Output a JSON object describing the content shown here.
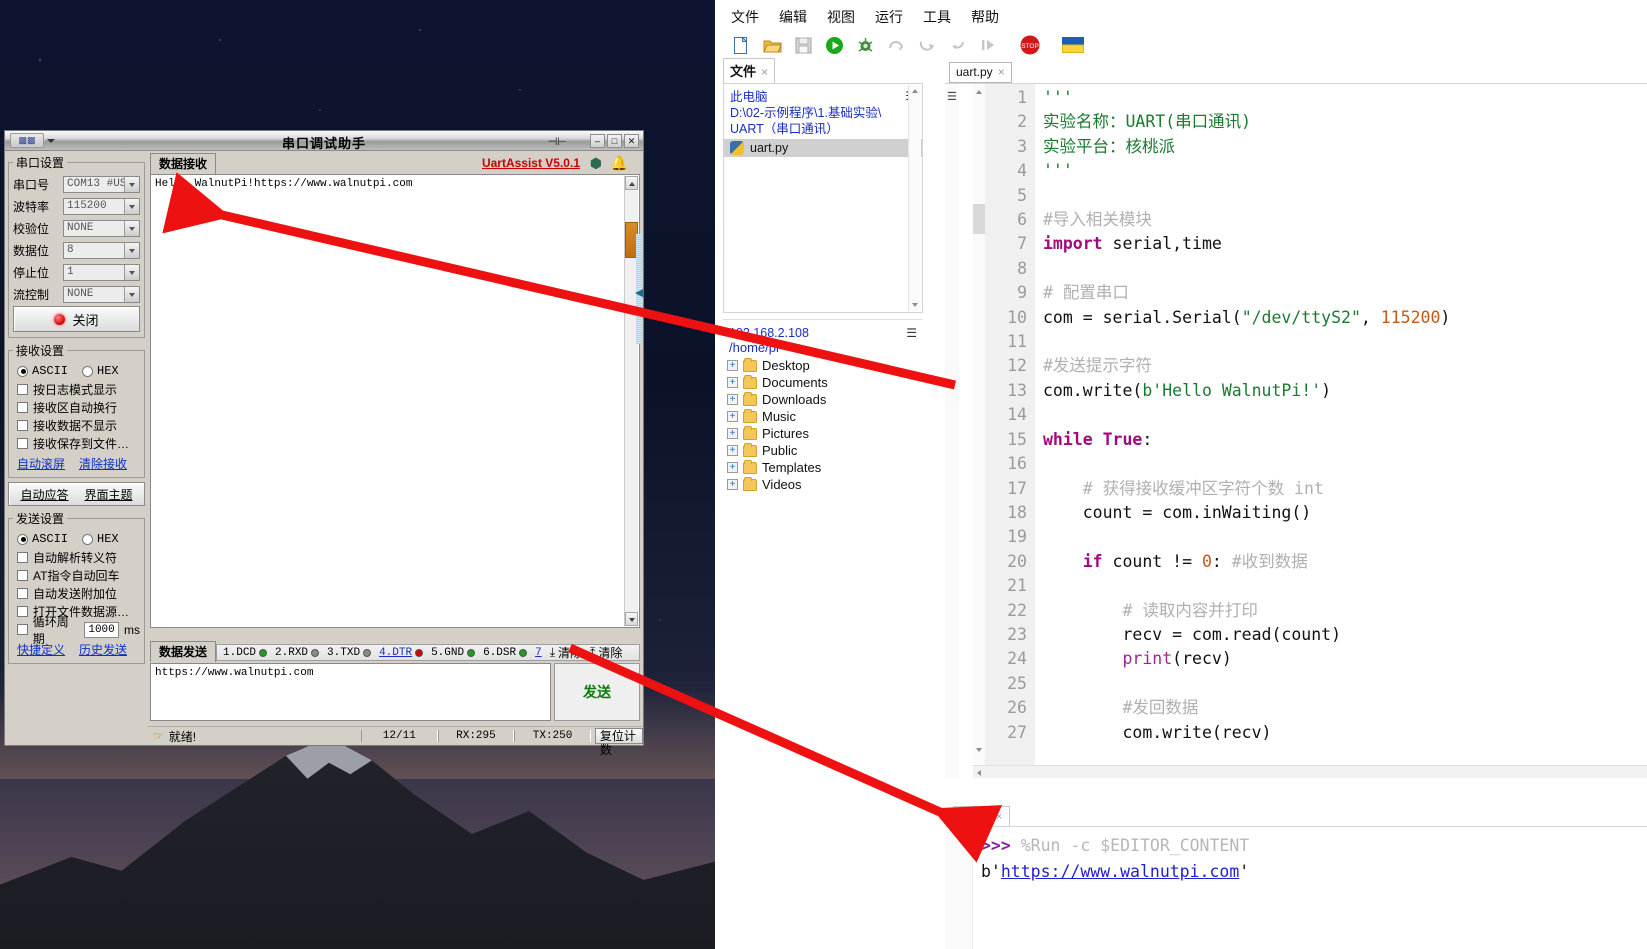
{
  "serial_window": {
    "title": "串口调试助手",
    "logo_label": "",
    "titlebar_buttons": [
      "–",
      "□",
      "✕"
    ],
    "serial_settings": {
      "legend": "串口设置",
      "fields": [
        {
          "label": "串口号",
          "value": "COM13 #US"
        },
        {
          "label": "波特率",
          "value": "115200"
        },
        {
          "label": "校验位",
          "value": "NONE"
        },
        {
          "label": "数据位",
          "value": "8"
        },
        {
          "label": "停止位",
          "value": "1"
        },
        {
          "label": "流控制",
          "value": "NONE"
        }
      ],
      "close_button": "关闭"
    },
    "receive_settings": {
      "legend": "接收设置",
      "mode_ascii": "ASCII",
      "mode_hex": "HEX",
      "checkboxes": [
        "按日志模式显示",
        "接收区自动换行",
        "接收数据不显示",
        "接收保存到文件…"
      ],
      "links": [
        "自动滚屏",
        "清除接收"
      ]
    },
    "mid_buttons": [
      "自动应答",
      "界面主题"
    ],
    "send_settings": {
      "legend": "发送设置",
      "mode_ascii": "ASCII",
      "mode_hex": "HEX",
      "checkboxes": [
        "自动解析转义符",
        "AT指令自动回车",
        "自动发送附加位",
        "打开文件数据源…"
      ],
      "cycle_label": "循环周期",
      "cycle_value": "1000",
      "cycle_unit": "ms",
      "links": [
        "快捷定义",
        "历史发送"
      ]
    },
    "receive_tab": "数据接收",
    "receive_text": "Hello WalnutPi!https://www.walnutpi.com",
    "brand": "UartAssist V5.0.1",
    "send_tab": "数据发送",
    "signals": [
      {
        "name": "1.DCD",
        "color": "#1f9b1f"
      },
      {
        "name": "2.RXD",
        "color": "#8a8a8a"
      },
      {
        "name": "3.TXD",
        "color": "#8a8a8a"
      },
      {
        "name": "4.DTR",
        "color": "#d40000",
        "underline": true
      },
      {
        "name": "5.GND",
        "color": "#1f9b1f"
      },
      {
        "name": "6.DSR",
        "color": "#1f9b1f"
      },
      {
        "name": "7",
        "color": "#1f9b1f",
        "underline": true
      }
    ],
    "clear_buttons": [
      "清除",
      "清除"
    ],
    "send_text": "https://www.walnutpi.com",
    "send_button": "发送",
    "status": {
      "ready": "就绪!",
      "ratio": "12/11",
      "rx": "RX:295",
      "tx": "TX:250",
      "reset_button": "复位计数"
    }
  },
  "thonny": {
    "menu": [
      "文件",
      "编辑",
      "视图",
      "运行",
      "工具",
      "帮助"
    ],
    "toolbar_icons": [
      "new-file-icon",
      "open-folder-icon",
      "save-icon",
      "run-icon",
      "debug-icon",
      "step-over-icon",
      "step-into-icon",
      "step-out-icon",
      "resume-icon",
      "stop-icon",
      "switch-interpreter-icon"
    ],
    "files_tab": "文件",
    "local": {
      "computer_label": "此电脑",
      "path_line1": "D:\\02-示例程序\\1.基础实验\\",
      "path_line2": "UART（串口通讯）",
      "selected_file": "uart.py"
    },
    "remote": {
      "ip": "192.168.2.108",
      "path": "/home/pi",
      "folders": [
        "Desktop",
        "Documents",
        "Downloads",
        "Music",
        "Pictures",
        "Public",
        "Templates",
        "Videos"
      ]
    },
    "editor_tab": "uart.py",
    "code_lines": [
      {
        "n": 1,
        "tokens": [
          {
            "t": "'''",
            "c": "k-str"
          }
        ]
      },
      {
        "n": 2,
        "tokens": [
          {
            "t": "实验名称：UART(串口通讯)",
            "c": "k-str"
          }
        ]
      },
      {
        "n": 3,
        "tokens": [
          {
            "t": "实验平台：核桃派",
            "c": "k-str"
          }
        ]
      },
      {
        "n": 4,
        "tokens": [
          {
            "t": "'''",
            "c": "k-str"
          }
        ]
      },
      {
        "n": 5,
        "tokens": []
      },
      {
        "n": 6,
        "tokens": [
          {
            "t": "#导入相关模块",
            "c": "k-com"
          }
        ]
      },
      {
        "n": 7,
        "tokens": [
          {
            "t": "import",
            "c": "k-kw"
          },
          {
            "t": " serial,time",
            "c": "k-plain"
          }
        ]
      },
      {
        "n": 8,
        "tokens": []
      },
      {
        "n": 9,
        "tokens": [
          {
            "t": "# 配置串口",
            "c": "k-com"
          }
        ]
      },
      {
        "n": 10,
        "tokens": [
          {
            "t": "com = serial.Serial(",
            "c": "k-plain"
          },
          {
            "t": "\"/dev/ttyS2\"",
            "c": "k-str"
          },
          {
            "t": ", ",
            "c": "k-plain"
          },
          {
            "t": "115200",
            "c": "k-num"
          },
          {
            "t": ")",
            "c": "k-plain"
          }
        ]
      },
      {
        "n": 11,
        "tokens": []
      },
      {
        "n": 12,
        "tokens": [
          {
            "t": "#发送提示字符",
            "c": "k-com"
          }
        ]
      },
      {
        "n": 13,
        "tokens": [
          {
            "t": "com.write(",
            "c": "k-plain"
          },
          {
            "t": "b'Hello WalnutPi!'",
            "c": "k-str"
          },
          {
            "t": ")",
            "c": "k-plain"
          }
        ]
      },
      {
        "n": 14,
        "tokens": []
      },
      {
        "n": 15,
        "tokens": [
          {
            "t": "while",
            "c": "k-kw"
          },
          {
            "t": " ",
            "c": "k-plain"
          },
          {
            "t": "True",
            "c": "k-kw"
          },
          {
            "t": ":",
            "c": "k-plain"
          }
        ]
      },
      {
        "n": 16,
        "tokens": []
      },
      {
        "n": 17,
        "tokens": [
          {
            "t": "    # 获得接收缓冲区字符个数 int",
            "c": "k-com"
          }
        ]
      },
      {
        "n": 18,
        "tokens": [
          {
            "t": "    count = com.inWaiting()",
            "c": "k-plain"
          }
        ]
      },
      {
        "n": 19,
        "tokens": []
      },
      {
        "n": 20,
        "tokens": [
          {
            "t": "    ",
            "c": "k-plain"
          },
          {
            "t": "if",
            "c": "k-kw"
          },
          {
            "t": " count != ",
            "c": "k-plain"
          },
          {
            "t": "0",
            "c": "k-num"
          },
          {
            "t": ": ",
            "c": "k-plain"
          },
          {
            "t": "#收到数据",
            "c": "k-com"
          }
        ]
      },
      {
        "n": 21,
        "tokens": []
      },
      {
        "n": 22,
        "tokens": [
          {
            "t": "        # 读取内容并打印",
            "c": "k-com"
          }
        ]
      },
      {
        "n": 23,
        "tokens": [
          {
            "t": "        recv = com.read(count)",
            "c": "k-plain"
          }
        ]
      },
      {
        "n": 24,
        "tokens": [
          {
            "t": "        ",
            "c": "k-plain"
          },
          {
            "t": "print",
            "c": "k-fn"
          },
          {
            "t": "(recv)",
            "c": "k-plain"
          }
        ]
      },
      {
        "n": 25,
        "tokens": []
      },
      {
        "n": 26,
        "tokens": [
          {
            "t": "        #发回数据",
            "c": "k-com"
          }
        ]
      },
      {
        "n": 27,
        "tokens": [
          {
            "t": "        com.write(recv)",
            "c": "k-plain"
          }
        ]
      }
    ],
    "shell_tab": "Shell",
    "shell": {
      "prompt": ">>>",
      "command": "%Run -c $EDITOR_CONTENT",
      "out_prefix": "b'",
      "out_link": "https://www.walnutpi.com",
      "out_suffix": "'"
    }
  },
  "annotations": {
    "arrow_color": "#ee1111",
    "arrow_1_desc": "arrow from editor line 13 to serial receive text",
    "arrow_2_desc": "arrow from send textbox to shell output"
  }
}
